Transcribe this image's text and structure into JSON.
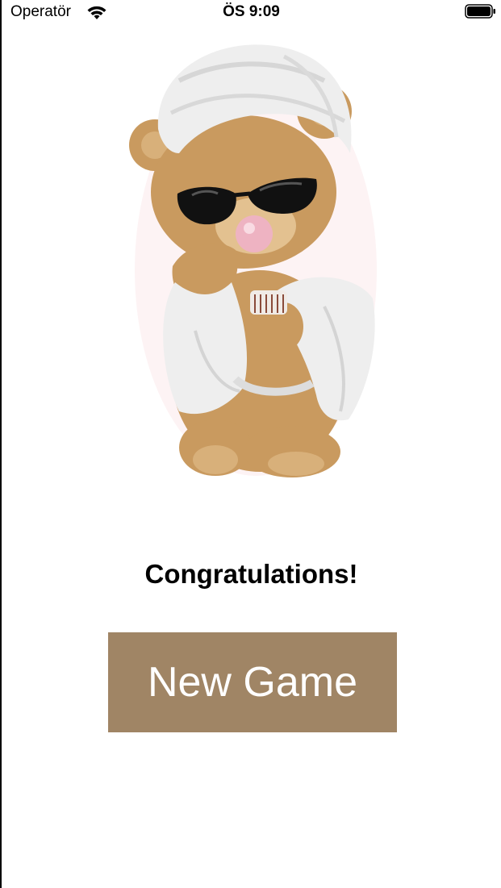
{
  "status_bar": {
    "carrier": "Operatör",
    "time": "ÖS 9:09",
    "icons": [
      "wifi-icon",
      "battery-icon"
    ]
  },
  "sticker": {
    "subject": "teddy-bear-in-bathrobe-illustration"
  },
  "main": {
    "message": "Congratulations!",
    "new_game_label": "New Game"
  },
  "colors": {
    "button_background": "#a08565",
    "button_text": "#ffffff",
    "background": "#ffffff"
  }
}
